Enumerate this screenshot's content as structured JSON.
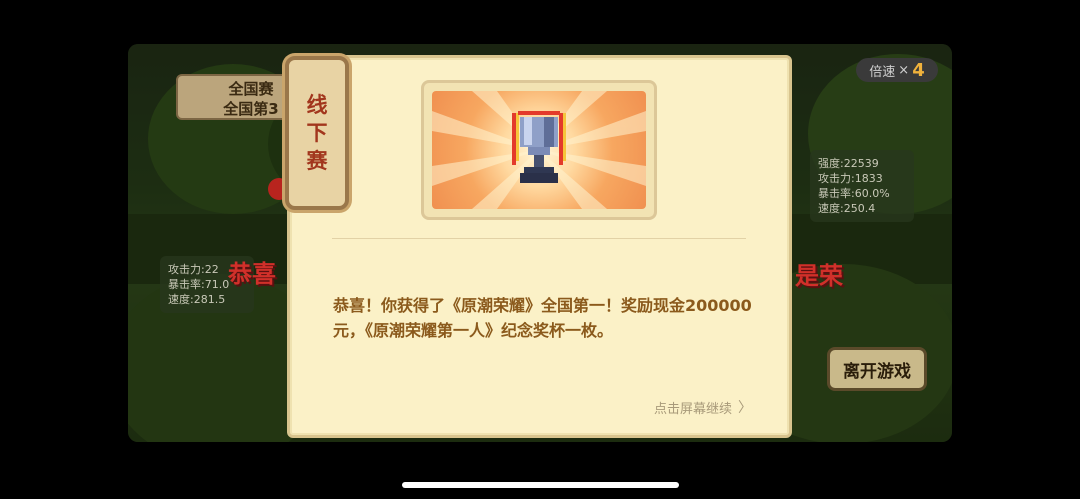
{
  "background": {
    "rank_line1": "全国赛",
    "rank_line2": "全国第3",
    "speed_label": "倍速",
    "speed_mult": "×",
    "speed_value": "4",
    "stats_right": [
      "强度:22539",
      "攻击力:1833",
      "暴击率:60.0%",
      "速度:250.4"
    ],
    "stats_left": [
      "攻击力:22",
      "暴击率:71.0",
      "速度:281.5"
    ],
    "banner_left": "恭喜",
    "banner_right": "是荣",
    "leave_button": "离开游戏"
  },
  "dialog": {
    "tab_chars": [
      "线",
      "下",
      "赛"
    ],
    "message": "恭喜！你获得了《原潮荣耀》全国第一！奖励现金200000元，《原潮荣耀第一人》纪念奖杯一枚。",
    "continue_label": "点击屏幕继续",
    "continue_icon": "chevron-right-icon",
    "trophy_icon": "trophy-icon"
  },
  "colors": {
    "dialog_bg": "#fbf1c7",
    "message_text": "#8b5a1c",
    "tab_text": "#a2361d",
    "banner_red": "#d1302a"
  }
}
